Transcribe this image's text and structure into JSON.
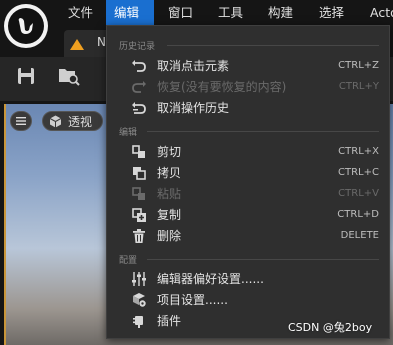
{
  "menubar": {
    "items": [
      "文件",
      "编辑",
      "窗口",
      "工具",
      "构建",
      "选择",
      "Acto"
    ],
    "active_index": 1
  },
  "tab": {
    "label": "N"
  },
  "viewport": {
    "menu_icon": "hamburger-icon",
    "perspective_label": "透视"
  },
  "dropdown": {
    "sections": [
      {
        "header": "历史记录",
        "items": [
          {
            "label": "取消点击元素",
            "shortcut": "CTRL+Z",
            "icon": "undo-icon",
            "enabled": true
          },
          {
            "label": "恢复(没有要恢复的内容)",
            "shortcut": "CTRL+Y",
            "icon": "redo-icon",
            "enabled": false
          },
          {
            "label": "取消操作历史",
            "shortcut": "",
            "icon": "history-icon",
            "enabled": true
          }
        ]
      },
      {
        "header": "编辑",
        "items": [
          {
            "label": "剪切",
            "shortcut": "CTRL+X",
            "icon": "cut-icon",
            "enabled": true
          },
          {
            "label": "拷贝",
            "shortcut": "CTRL+C",
            "icon": "copy-icon",
            "enabled": true
          },
          {
            "label": "粘贴",
            "shortcut": "CTRL+V",
            "icon": "paste-icon",
            "enabled": false
          },
          {
            "label": "复制",
            "shortcut": "CTRL+D",
            "icon": "duplicate-icon",
            "enabled": true
          },
          {
            "label": "删除",
            "shortcut": "DELETE",
            "icon": "trash-icon",
            "enabled": true
          }
        ]
      },
      {
        "header": "配置",
        "items": [
          {
            "label": "编辑器偏好设置......",
            "shortcut": "",
            "icon": "sliders-icon",
            "enabled": true
          },
          {
            "label": "项目设置......",
            "shortcut": "",
            "icon": "project-settings-icon",
            "enabled": true
          },
          {
            "label": "插件",
            "shortcut": "",
            "icon": "plugin-icon",
            "enabled": true
          }
        ]
      }
    ]
  },
  "watermark": "CSDN @兔2boy",
  "colors": {
    "menu_active": "#1a6fd0",
    "dropdown_bg": "#2f2f2f",
    "disabled_text": "#6a6a6a",
    "tab_accent": "#f0a020"
  }
}
